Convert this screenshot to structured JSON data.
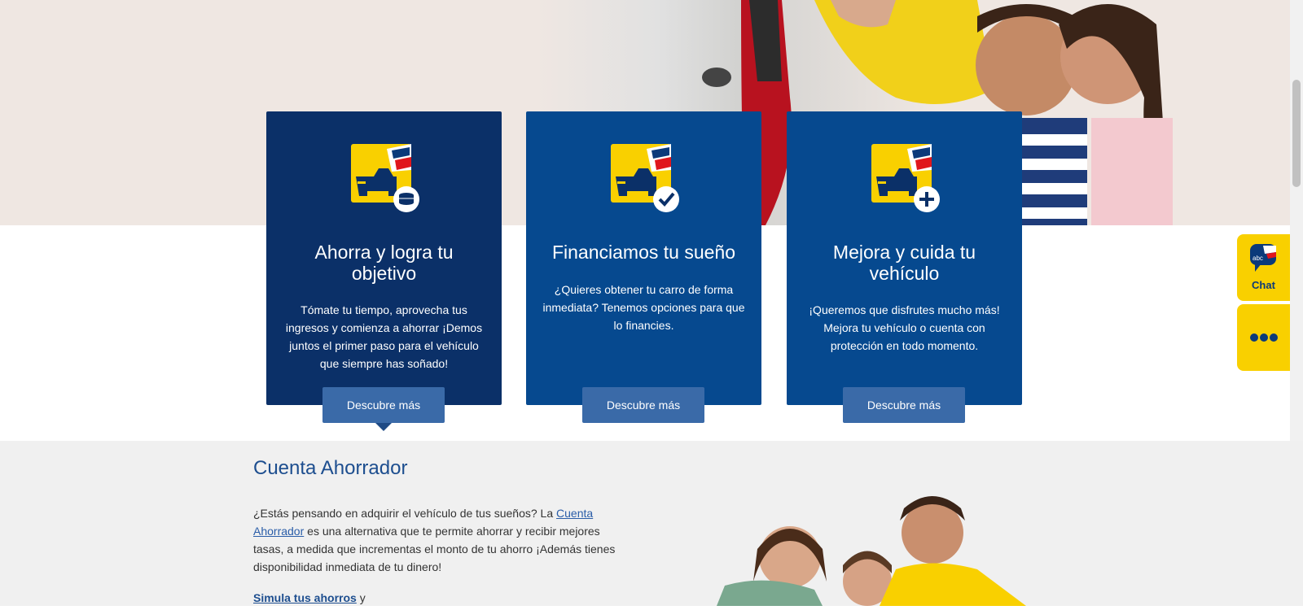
{
  "cards": [
    {
      "title": "Ahorra y logra tu objetivo",
      "description": "Tómate tu tiempo, aprovecha tus ingresos y comienza a ahorrar ¡Demos juntos el primer paso para el vehículo que siempre has soñado!",
      "button_label": "Descubre más",
      "badge_icon": "coins-icon"
    },
    {
      "title": "Financiamos tu sueño",
      "description": "¿Quieres obtener tu carro de forma inmediata? Tenemos opciones para que lo financies.",
      "button_label": "Descubre más",
      "badge_icon": "checkmark-icon"
    },
    {
      "title": "Mejora y cuida tu vehículo",
      "description": "¡Queremos que disfrutes mucho más! Mejora tu vehículo o cuenta con protección en todo momento.",
      "button_label": "Descubre más",
      "badge_icon": "plus-icon"
    }
  ],
  "side_widgets": {
    "chat_label": "Chat",
    "chat_badge": "abc"
  },
  "section": {
    "title": "Cuenta Ahorrador",
    "text_before_link": "¿Estás pensando en adquirir el vehículo de tus sueños?  La ",
    "link_text": "Cuenta Ahorrador",
    "text_after_link": " es una alternativa que te permite ahorrar y recibir mejores tasas, a medida que incrementas el monto de tu ahorro ¡Además tienes disponibilidad inmediata de tu dinero!",
    "simula_link": "Simula tus ahorros",
    "simula_after": " y"
  },
  "colors": {
    "card_active": "#0b3068",
    "card_normal": "#06498f",
    "button": "#3a6aa8",
    "accent_yellow": "#f9d000",
    "title_blue": "#1d4e8f"
  }
}
